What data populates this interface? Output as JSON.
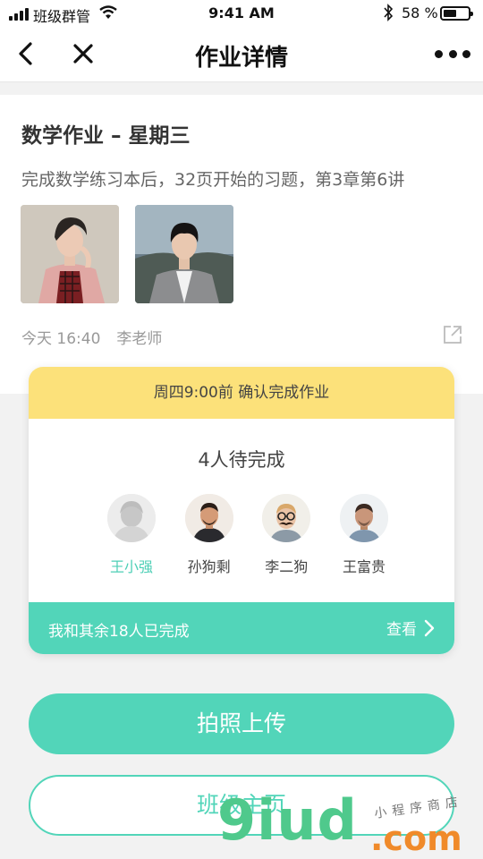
{
  "status_bar": {
    "carrier": "班级群管",
    "time": "9:41 AM",
    "battery_pct": "58 %"
  },
  "nav": {
    "title": "作业详情"
  },
  "homework": {
    "title": "数学作业 – 星期三",
    "description": "完成数学练习本后，32页开始的习题，第3章第6讲",
    "time": "今天 16:40",
    "teacher": "李老师"
  },
  "deadline_card": {
    "deadline_text": "周四9:00前 确认完成作业",
    "pending_title": "4人待完成",
    "people": [
      {
        "name": "王小强",
        "active": true
      },
      {
        "name": "孙狗剩",
        "active": false
      },
      {
        "name": "李二狗",
        "active": false
      },
      {
        "name": "王富贵",
        "active": false
      }
    ],
    "done_text": "我和其余18人已完成",
    "view_label": "查看"
  },
  "buttons": {
    "upload": "拍照上传",
    "class_home": "班级主页"
  },
  "watermark": {
    "big": "9iud",
    "com": ".com",
    "small": "小程序商店"
  },
  "colors": {
    "accent": "#52d5b9",
    "deadline_bg": "#fce17a",
    "active_name": "#4ecfb6"
  }
}
